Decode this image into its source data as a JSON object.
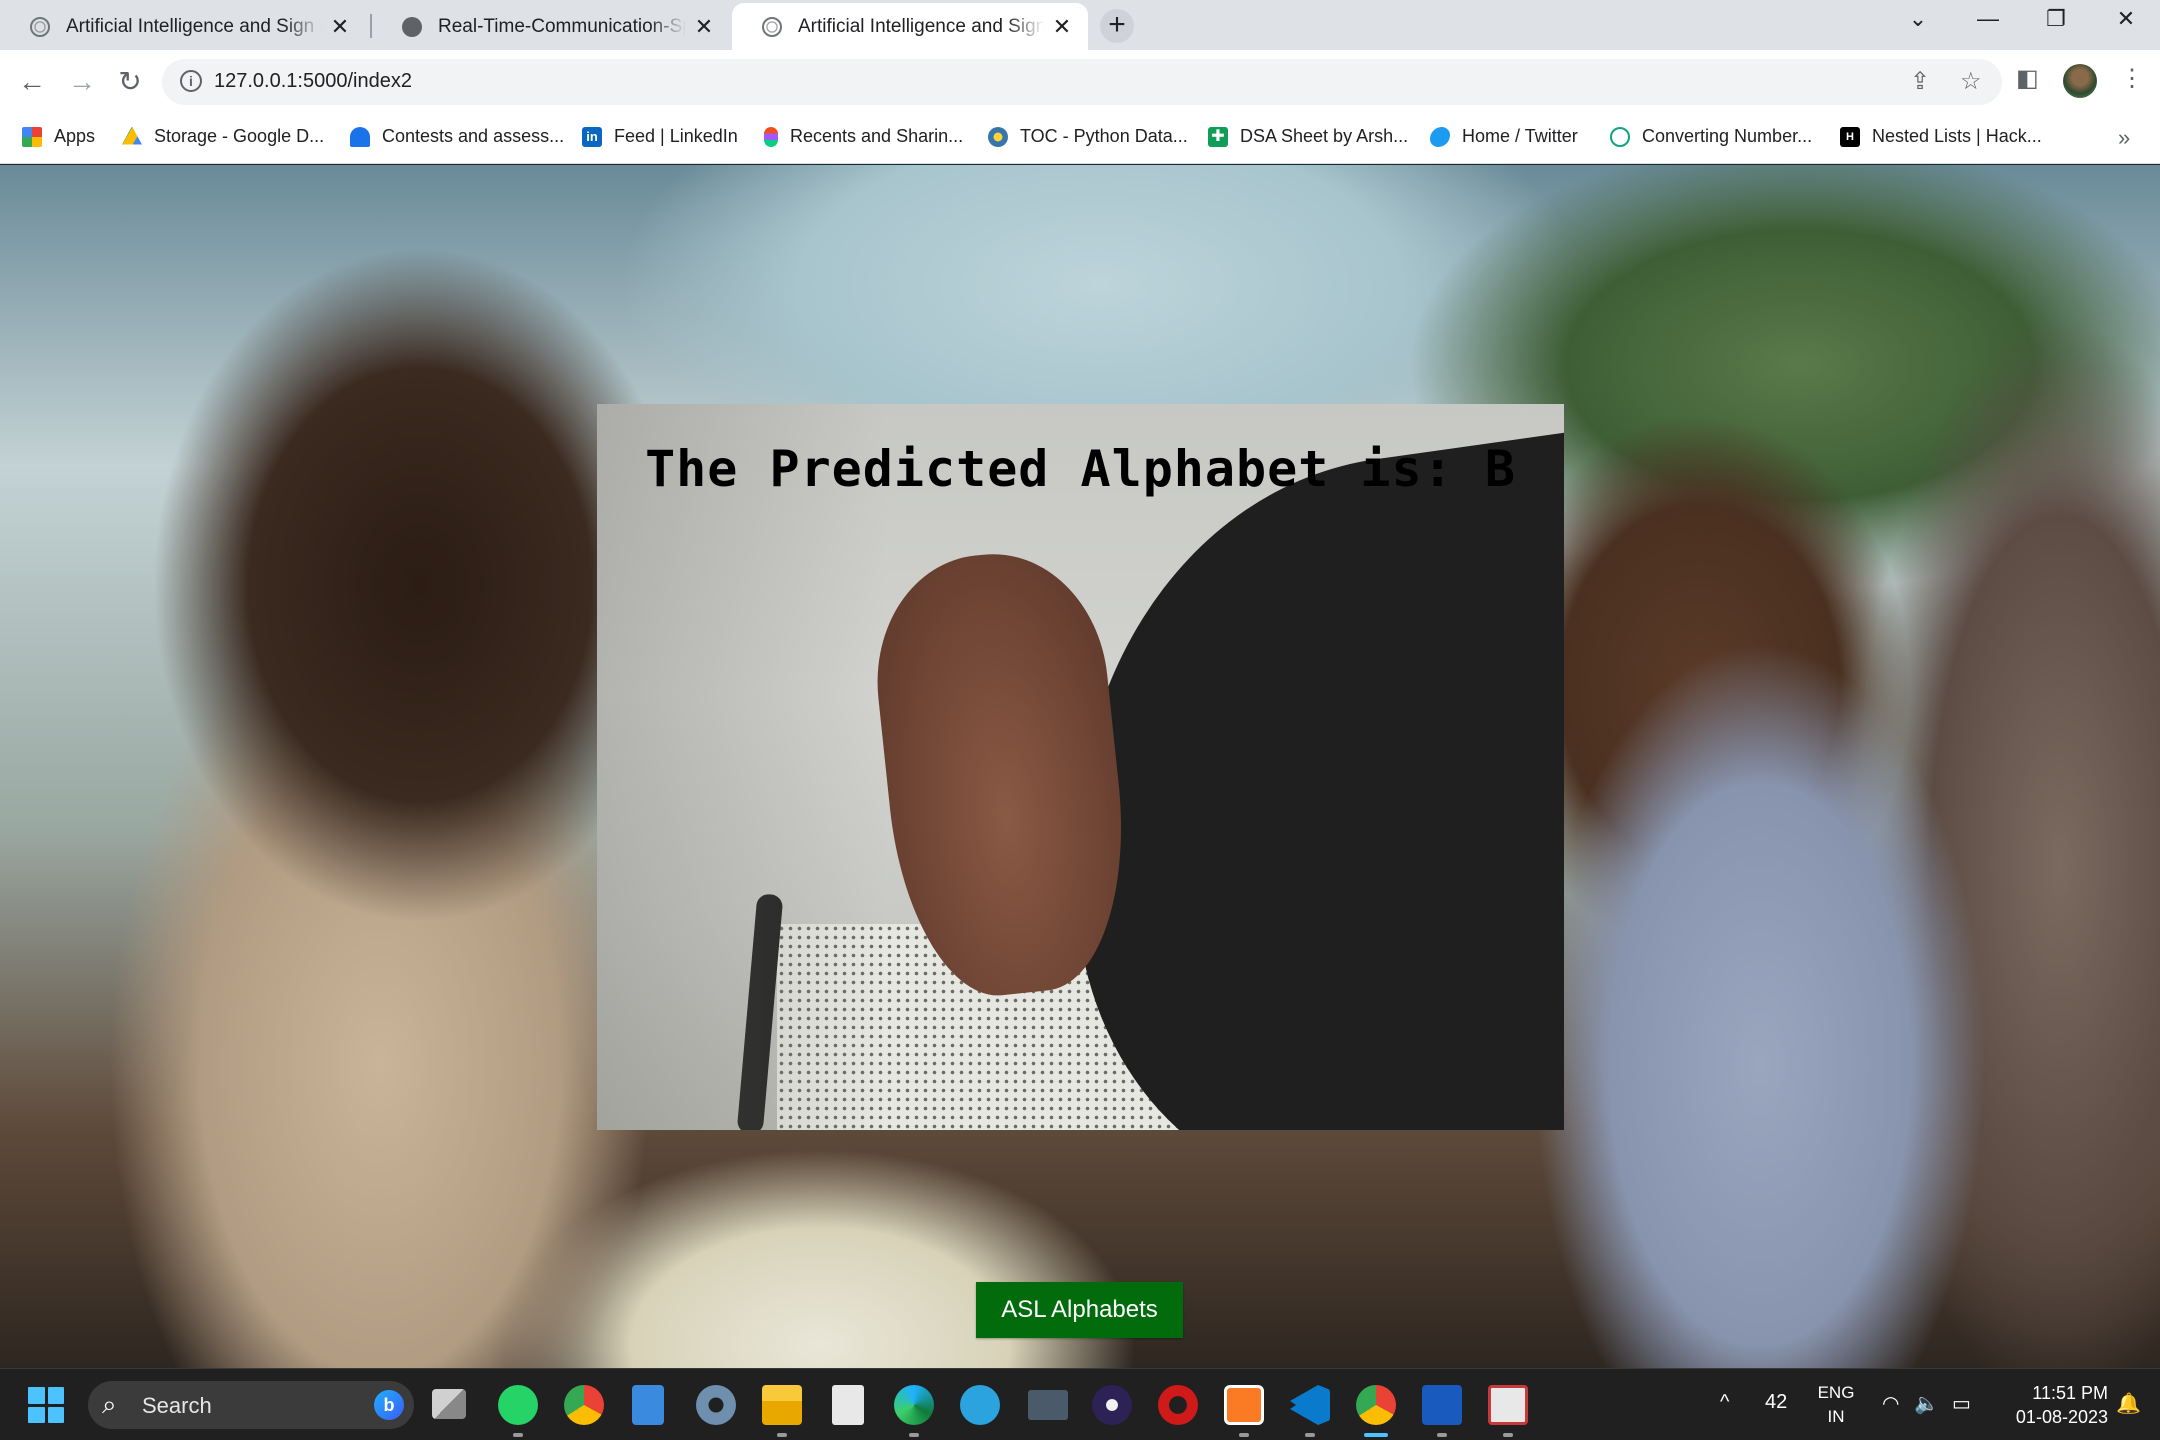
{
  "tabs": [
    {
      "title": "Artificial Intelligence and Sign Re",
      "icon": "globe-icon",
      "active": false
    },
    {
      "title": "Real-Time-Communication-Speci",
      "icon": "github-icon",
      "active": false
    },
    {
      "title": "Artificial Intelligence and Sign Re",
      "icon": "globe-icon",
      "active": true
    }
  ],
  "address": {
    "url": "127.0.0.1:5000/index2"
  },
  "bookmarks": [
    {
      "label": "Apps",
      "icon": "apps-grid-icon",
      "color": "#ea4335"
    },
    {
      "label": "Storage - Google D...",
      "icon": "google-drive-icon",
      "color": "#fbbc04"
    },
    {
      "label": "Contests and assess...",
      "icon": "contest-icon",
      "color": "#1a73e8"
    },
    {
      "label": "Feed | LinkedIn",
      "icon": "linkedin-icon",
      "color": "#0a66c2"
    },
    {
      "label": "Recents and Sharin...",
      "icon": "figma-icon",
      "color": "#f24e1e"
    },
    {
      "label": "TOC - Python Data...",
      "icon": "python-icon",
      "color": "#3776ab"
    },
    {
      "label": "DSA Sheet by Arsh...",
      "icon": "sheets-icon",
      "color": "#0f9d58"
    },
    {
      "label": "Home / Twitter",
      "icon": "twitter-icon",
      "color": "#1d9bf0"
    },
    {
      "label": "Converting Number...",
      "icon": "chatgpt-icon",
      "color": "#10a37f"
    },
    {
      "label": "Nested Lists | Hack...",
      "icon": "hackerrank-icon",
      "color": "#000000"
    }
  ],
  "main": {
    "prediction_text": "The Predicted Alphabet is: B",
    "button_label": "ASL Alphabets",
    "button_color": "#026b0c"
  },
  "taskbar": {
    "search_label": "Search",
    "weather_temp": "42",
    "language_line1": "ENG",
    "language_line2": "IN",
    "time": "11:51 PM",
    "date": "01-08-2023",
    "apps": [
      "task-view-icon",
      "whatsapp-icon",
      "chrome-icon",
      "notepad-icon",
      "settings-icon",
      "file-explorer-icon",
      "notepad-plus-icon",
      "edge-icon",
      "telegram-icon",
      "sql-icon",
      "eclipse-icon",
      "antivirus-icon",
      "xampp-icon",
      "vscode-icon",
      "chrome-profile-icon",
      "word-icon",
      "snipping-tool-icon"
    ]
  }
}
